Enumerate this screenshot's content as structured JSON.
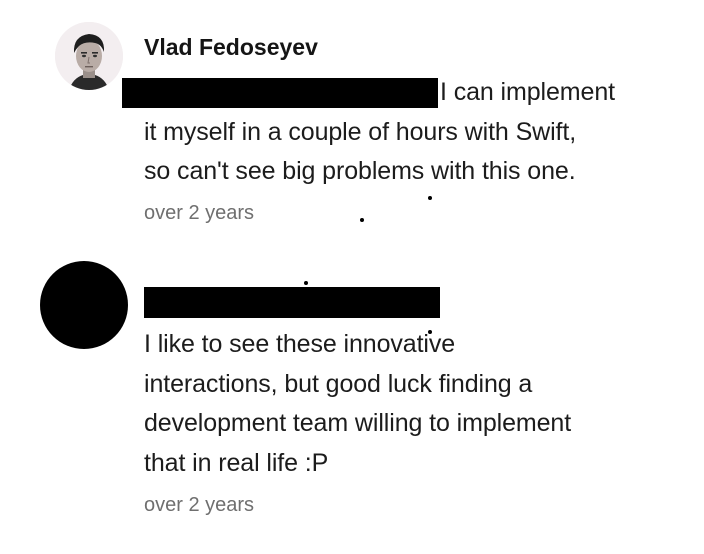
{
  "comments": [
    {
      "author": "Vlad Fedoseyev",
      "body_lines": [
        "I can implement",
        "it myself in a couple of hours with Swift,",
        "so can't see big problems with this one."
      ],
      "time": "over 2 years"
    },
    {
      "author": "",
      "body_lines": [
        "I like to see these innovative",
        "interactions, but good luck finding a",
        "development team willing to implement",
        "that in real life :P"
      ],
      "time": "over 2 years"
    }
  ]
}
